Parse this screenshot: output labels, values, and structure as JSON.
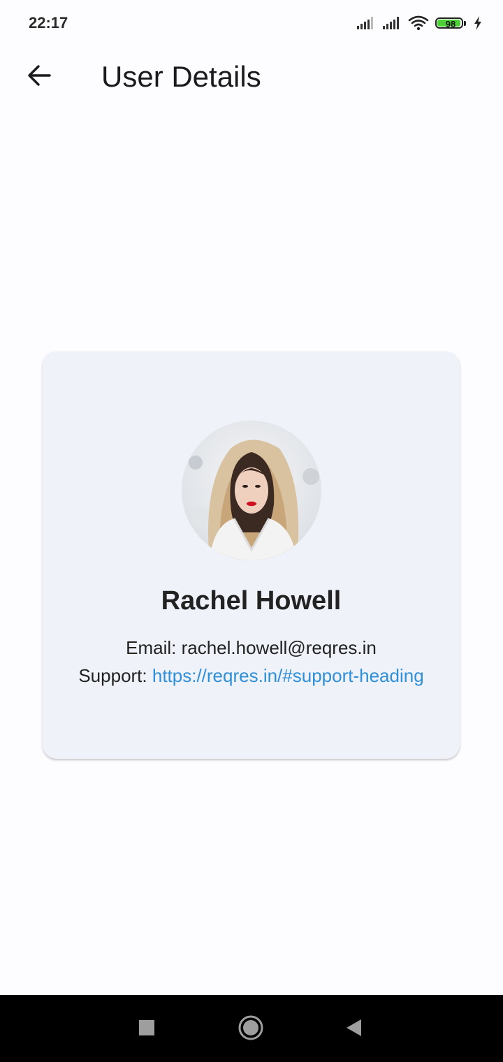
{
  "status_bar": {
    "time": "22:17",
    "battery_level": "98",
    "battery_fraction": 0.98,
    "battery_color": "#4cd137",
    "icons": [
      "signal-icon",
      "signal-icon",
      "wifi-icon",
      "battery-icon",
      "charging-icon"
    ]
  },
  "app_bar": {
    "back_icon": "arrow-back-icon",
    "title": "User Details"
  },
  "user_card": {
    "avatar_icon": "user-avatar-photo",
    "name": "Rachel Howell",
    "email_label": "Email: ",
    "email": "rachel.howell@reqres.in",
    "support_label": "Support: ",
    "support_url": "https://reqres.in/#support-heading",
    "link_color": "#2f8fd8",
    "card_color": "#eff2f9"
  },
  "nav_bar": {
    "recents_icon": "square-icon",
    "home_icon": "circle-icon",
    "back_icon": "triangle-back-icon"
  }
}
